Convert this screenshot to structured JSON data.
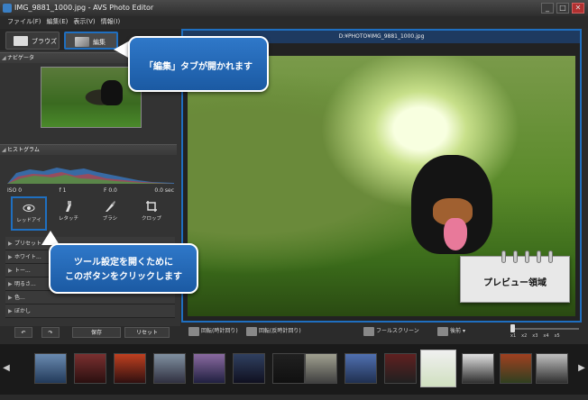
{
  "window": {
    "title": "IMG_9881_1000.jpg - AVS Photo Editor",
    "min": "_",
    "max": "□",
    "close": "✕"
  },
  "menu": [
    "ファイル(F)",
    "編集(E)",
    "表示(V)",
    "情報(I)"
  ],
  "tabs": {
    "browse": "ブラウズ",
    "edit": "編集"
  },
  "sections": {
    "navigator": "ナビゲータ",
    "histogram": "ヒストグラム"
  },
  "histogram_stats": [
    "ISO 0",
    "f 1",
    "F 0.0",
    "0.0 sec"
  ],
  "tools": [
    "レッドアイ",
    "レタッチ",
    "ブラシ",
    "クロップ"
  ],
  "tool_list": [
    "プリセット",
    "ホワイト...",
    "トー...",
    "明るさ...",
    "色...",
    "ぼかし"
  ],
  "buttons": {
    "undo": "↶",
    "redo": "↷",
    "save": "保存",
    "reset": "リセット"
  },
  "preview": {
    "path": "D:¥PHOTO¥IMG_9881_1000.jpg"
  },
  "preview_toolbar": {
    "rotate_cw": "回転(時計回り)",
    "rotate_ccw": "回転(反時計回り)",
    "fullscreen": "フールスクリーン",
    "compare": "後前",
    "compare_arrow": "▾"
  },
  "zoom": [
    "x1",
    "x2",
    "x3",
    "x4",
    "x5"
  ],
  "callouts": {
    "edit_tab": "「編集」タブが開かれます",
    "tool_button_line1": "ツール設定を開くために",
    "tool_button_line2": "このボタンをクリックします",
    "preview_area": "プレビュー領域"
  },
  "colors": {
    "accent": "#1f6fc0",
    "background": "#2b2b2b"
  }
}
